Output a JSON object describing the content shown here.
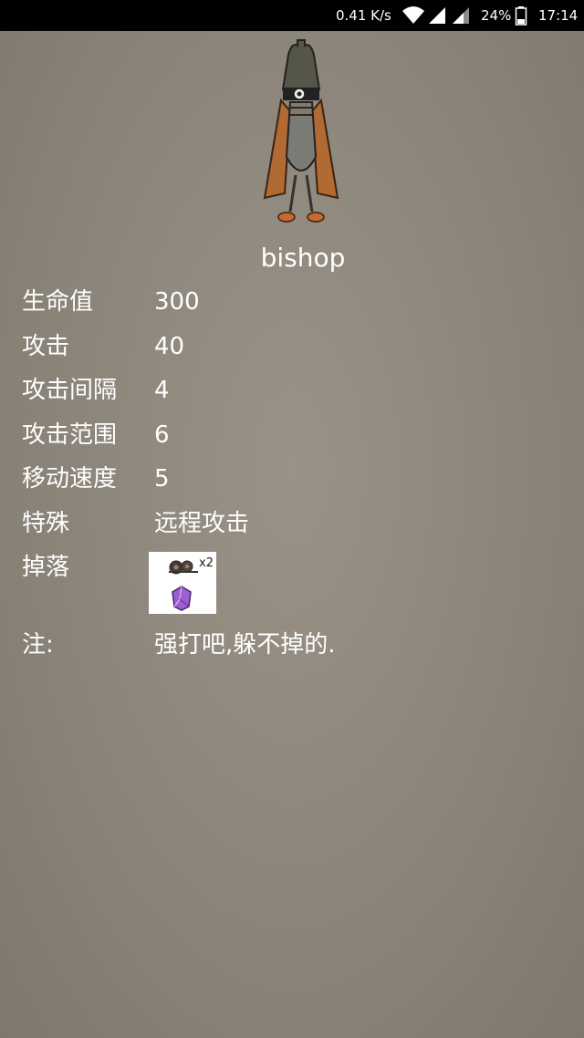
{
  "status_bar": {
    "speed": "0.41 K/s",
    "battery_percent": "24%",
    "time": "17:14",
    "icons": [
      "wifi-icon",
      "signal-icon",
      "signal-icon",
      "battery-icon"
    ]
  },
  "character": {
    "name": "bishop",
    "image": "bishop-figure"
  },
  "stats": [
    {
      "label": "生命值",
      "value": "300"
    },
    {
      "label": "攻击",
      "value": "40"
    },
    {
      "label": "攻击间隔",
      "value": "4"
    },
    {
      "label": "攻击范围",
      "value": "6"
    },
    {
      "label": "移动速度",
      "value": "5"
    },
    {
      "label": "特殊",
      "value": "远程攻击"
    }
  ],
  "drops": {
    "label": "掉落",
    "items": [
      {
        "icon": "gears-icon",
        "count": "x2"
      },
      {
        "icon": "purple-gem-icon"
      }
    ]
  },
  "note": {
    "label": "注:",
    "value": "强打吧,躲不掉的."
  },
  "colors": {
    "background": "#8e877c",
    "text": "#ffffff",
    "status_bar": "#000000"
  }
}
